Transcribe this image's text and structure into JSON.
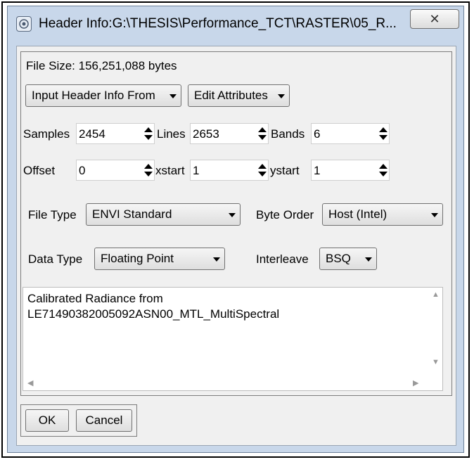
{
  "window": {
    "title": "Header Info:G:\\THESIS\\Performance_TCT\\RASTER\\05_R...",
    "close_glyph": "✕"
  },
  "file_size": "File Size: 156,251,088 bytes",
  "toolbar": {
    "input_header_label": "Input Header Info From",
    "edit_attributes_label": "Edit Attributes"
  },
  "dimensions": {
    "samples_label": "Samples",
    "samples_value": "2454",
    "lines_label": "Lines",
    "lines_value": "2653",
    "bands_label": "Bands",
    "bands_value": "6",
    "offset_label": "Offset",
    "offset_value": "0",
    "xstart_label": "xstart",
    "xstart_value": "1",
    "ystart_label": "ystart",
    "ystart_value": "1"
  },
  "format": {
    "file_type_label": "File Type",
    "file_type_value": "ENVI Standard",
    "byte_order_label": "Byte Order",
    "byte_order_value": "Host (Intel)",
    "data_type_label": "Data Type",
    "data_type_value": "Floating Point",
    "interleave_label": "Interleave",
    "interleave_value": "BSQ"
  },
  "description": {
    "line1": "Calibrated Radiance from",
    "line2": "LE71490382005092ASN00_MTL_MultiSpectral"
  },
  "actions": {
    "ok_label": "OK",
    "cancel_label": "Cancel"
  },
  "icons": {
    "window_icon": "envi-app-icon",
    "spinner": "up-down-arrows-icon",
    "dropdown": "chevron-down-icon"
  },
  "colors": {
    "window_frame": "#c8d7ea",
    "client_bg": "#f0f0f0"
  }
}
